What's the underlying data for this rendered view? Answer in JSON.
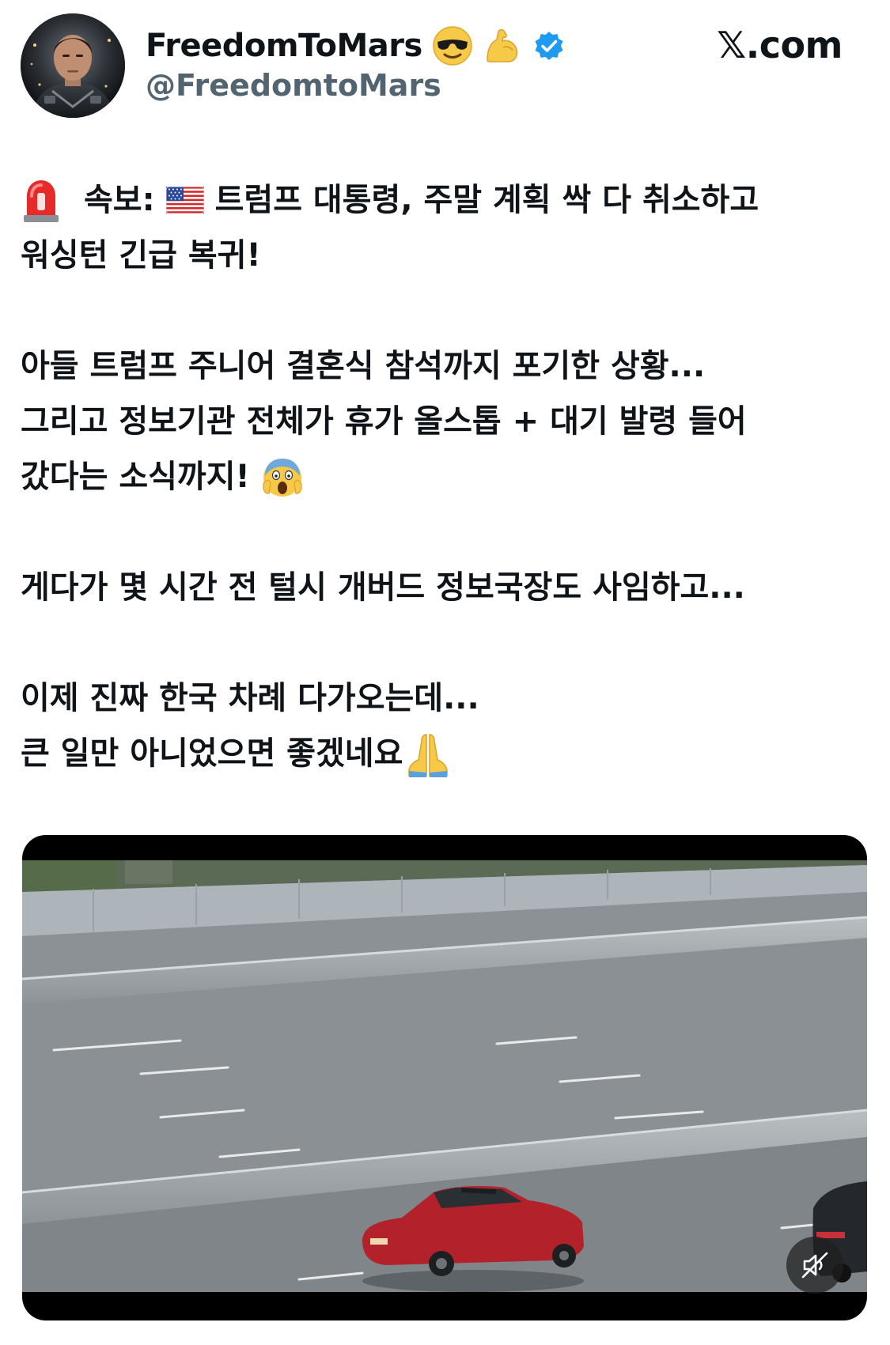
{
  "author": {
    "display_name": "FreedomToMars",
    "handle": "@FreedomtoMars",
    "name_emojis": [
      "sunglasses-emoji",
      "flexed-biceps-emoji"
    ],
    "verified": true,
    "verified_color": "#1d9bf0"
  },
  "site_label": "𝕏.com",
  "tweet": {
    "lines": [
      {
        "icons": [
          "siren-emoji"
        ],
        "prefix": "속보:",
        "flag": "us-flag-emoji",
        "text": "트럼프 대통령, 주말 계획 싹 다 취소하고"
      },
      {
        "text": "워싱턴 긴급 복귀!"
      },
      {
        "text": "아들 트럼프 주니어 결혼식 참석까지 포기한 상황..."
      },
      {
        "text": "그리고 정보기관 전체가 휴가 올스톱 + 대기 발령 들어"
      },
      {
        "text": "갔다는 소식까지!",
        "trailing_icon": "screaming-face-emoji"
      },
      {
        "text": "게다가 몇 시간 전 털시 개버드 정보국장도 사임하고..."
      },
      {
        "text": "이제 진짜 한국 차례 다가오는데..."
      },
      {
        "text": "큰 일만 아니었으면 좋겠네요",
        "trailing_icon": "folded-hands-emoji"
      }
    ]
  },
  "media": {
    "type": "video",
    "description_icon": "highway-video-thumbnail",
    "mute_icon": "muted-speaker-icon"
  },
  "colors": {
    "text": "#0f1419",
    "secondary_text": "#536471",
    "verified_blue": "#1d9bf0"
  }
}
